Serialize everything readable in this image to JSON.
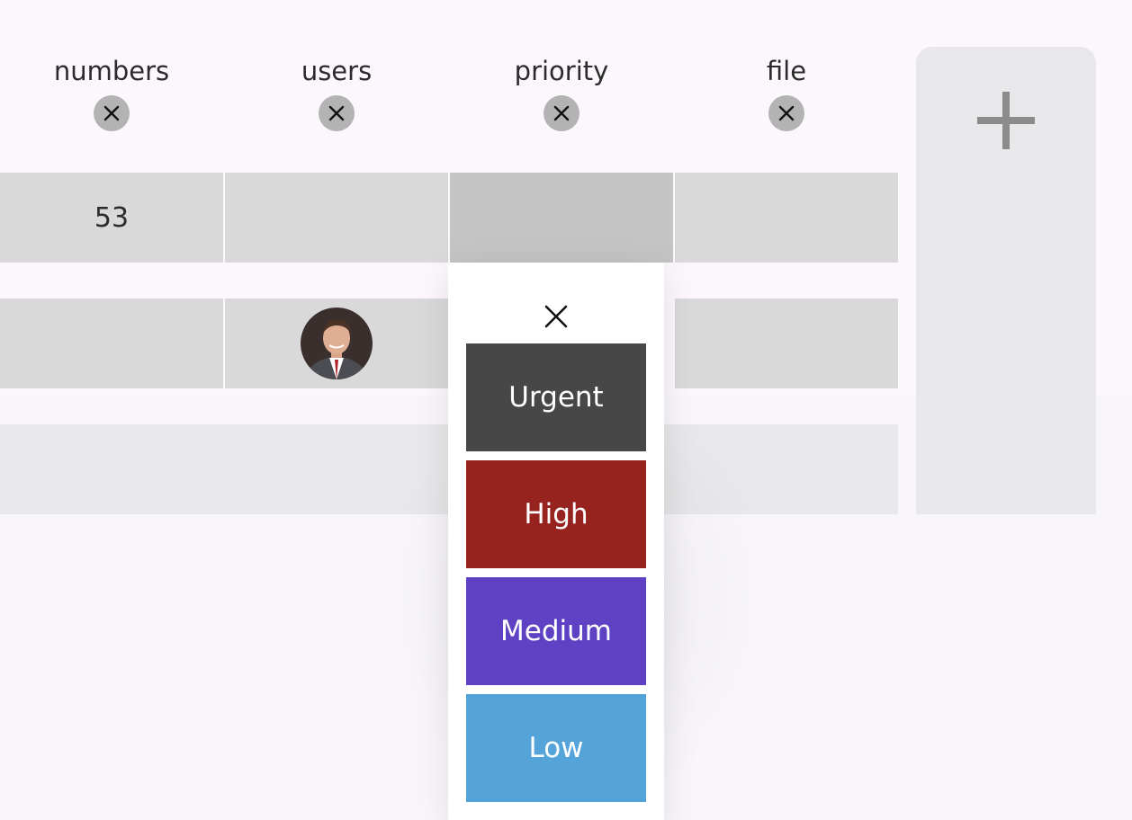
{
  "columns": [
    {
      "name": "numbers",
      "remove_icon": "close-icon"
    },
    {
      "name": "users",
      "remove_icon": "close-icon"
    },
    {
      "name": "priority",
      "remove_icon": "close-icon"
    },
    {
      "name": "file",
      "remove_icon": "close-icon"
    }
  ],
  "rows": [
    {
      "numbers": "53",
      "users": "",
      "priority": "",
      "file": ""
    },
    {
      "numbers": "",
      "users": "avatar",
      "priority": "",
      "file": ""
    }
  ],
  "add_column": {
    "icon": "plus-icon"
  },
  "priority_picker": {
    "close_icon": "close-icon",
    "options": [
      {
        "label": "Urgent",
        "color": "#474747"
      },
      {
        "label": "High",
        "color": "#96231e"
      },
      {
        "label": "Medium",
        "color": "#5e42c3"
      },
      {
        "label": "Low",
        "color": "#54a4da"
      }
    ]
  }
}
